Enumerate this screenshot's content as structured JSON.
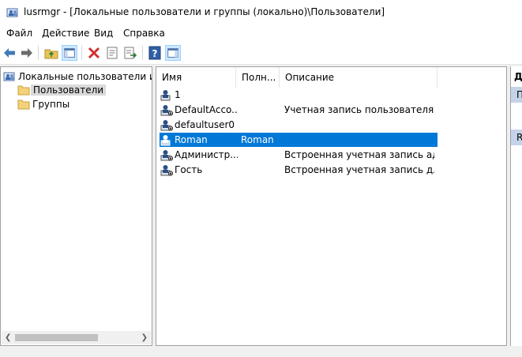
{
  "window": {
    "title": "lusrmgr - [Локальные пользователи и группы (локально)\\Пользователи]",
    "title_icon": "users-console-icon"
  },
  "menu": [
    "Файл",
    "Действие",
    "Вид",
    "Справка"
  ],
  "toolbar": {
    "buttons": [
      "back-arrow-icon",
      "forward-arrow-icon",
      "up-folder-icon",
      "show-hide-tree-icon",
      "delete-icon",
      "properties-icon",
      "export-list-icon",
      "help-icon",
      "show-hide-action-pane-icon"
    ]
  },
  "tree": {
    "root": "Локальные пользователи и гру",
    "items": [
      {
        "label": "Пользователи",
        "selected": true
      },
      {
        "label": "Группы",
        "selected": false
      }
    ]
  },
  "list": {
    "columns": [
      "Имя",
      "Полн...",
      "Описание"
    ],
    "rows": [
      {
        "name": "1",
        "full": "",
        "desc": "",
        "selected": false
      },
      {
        "name": "DefaultAcco...",
        "full": "",
        "desc": "Учетная запись пользователя, у...",
        "selected": false
      },
      {
        "name": "defaultuser0",
        "full": "",
        "desc": "",
        "selected": false
      },
      {
        "name": "Roman",
        "full": "Roman",
        "desc": "",
        "selected": true
      },
      {
        "name": "Администр...",
        "full": "",
        "desc": "Встроенная учетная запись адм...",
        "selected": false
      },
      {
        "name": "Гость",
        "full": "",
        "desc": "Встроенная учетная запись для ...",
        "selected": false
      }
    ]
  },
  "actions": {
    "header": "Д",
    "band1": "П",
    "band2": "R"
  },
  "colors": {
    "selection": "#0078d7",
    "tree_selection": "#d9d9d9"
  }
}
